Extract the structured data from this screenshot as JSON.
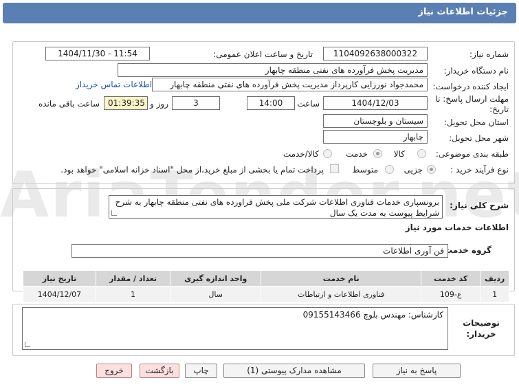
{
  "header": {
    "title": "جزئیات اطلاعات نیاز"
  },
  "form": {
    "need_number_label": "شماره نیاز:",
    "need_number": "1104092638000322",
    "announce_label": "تاریخ و ساعت اعلان عمومی:",
    "announce_value": "1404/11/30 - 11:54",
    "buyer_org_label": "نام دستگاه خریدار:",
    "buyer_org": "مدیریت پخش فرآورده های نفتی منطقه چابهار",
    "creator_label": "ایجاد کننده درخواست:",
    "creator": "محمدجواد نورزایی کارپرداز مدیریت پخش فرآورده های نفتی منطقه چابهار",
    "contact_link": "اطلاعات تماس خریدار",
    "deadline_label": "مهلت ارسال پاسخ: تا تاریخ:",
    "deadline_date": "1404/12/03",
    "time_label": "ساعت",
    "deadline_time": "14:00",
    "days_value": "3",
    "days_label": "روز و",
    "remaining_time": "01:39:35",
    "remaining_label": "ساعت باقی مانده",
    "province_label": "استان محل تحویل:",
    "province": "سیستان و بلوچستان",
    "city_label": "شهر محل تحویل:",
    "city": "چابهار",
    "category_label": "طبقه بندی موضوعی:",
    "category_options": [
      "کالا",
      "خدمت",
      "کالا/خدمت"
    ],
    "category_selected": "خدمت",
    "process_label": "نوع فرآیند خرید :",
    "process_options": [
      "جزیی",
      "متوسط"
    ],
    "process_selected": "جزیی",
    "payment_note": "پرداخت تمام یا بخشی از مبلغ خرید،از محل \"اسناد خزانه اسلامی\" خواهد بود."
  },
  "summary": {
    "label": "شرح کلی نیاز:",
    "text": "برونسپاری خدمات فناوری اطلاعات شرکت ملی پخش فراورده های نفتی منطقه چابهار به شرح شرایط پیوست به مدت یک سال"
  },
  "services": {
    "section_title": "اطلاعات خدمات مورد نیاز",
    "group_label": "گروه خدمت:",
    "group_value": "فن آوری اطلاعات",
    "columns": [
      "ردیف",
      "کد خدمت",
      "نام خدمت",
      "واحد اندازه گیری",
      "تعداد / مقدار",
      "تاریخ نیاز"
    ],
    "rows": [
      [
        "1",
        "ع-109",
        "فناوری اطلاعات و ارتباطات",
        "سال",
        "1",
        "1404/12/07"
      ]
    ]
  },
  "notes": {
    "label": "توضیحات خریدار:",
    "text": "کارشناس: مهندس بلوچ 09155143466"
  },
  "buttons": {
    "reply": "پاسخ به نیاز",
    "view_docs": "مشاهده مدارک پیوستی (1)",
    "print": "چاپ",
    "back": "بازگشت",
    "exit": "خروج"
  },
  "watermark": {
    "text": "AriaTender.net"
  },
  "colors": {
    "header": "#5a7fb3",
    "link": "#1a4fb3",
    "time_bg": "#fff5c8"
  }
}
